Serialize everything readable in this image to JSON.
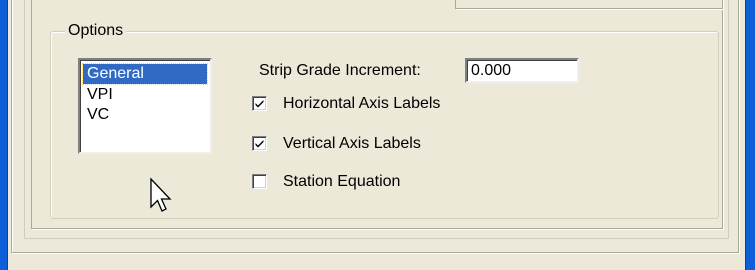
{
  "options_group": {
    "title": "Options",
    "list_items": [
      "General",
      "VPI",
      "VC"
    ],
    "selected_item": "General"
  },
  "strip_grade_increment": {
    "label": "Strip Grade Increment:",
    "value": "0.000"
  },
  "checkboxes": [
    {
      "label": "Horizontal Axis Labels",
      "checked": true
    },
    {
      "label": "Vertical Axis Labels",
      "checked": true
    },
    {
      "label": "Station Equation",
      "checked": false
    }
  ],
  "colors": {
    "window_frame": "#0c5fd9",
    "dialog_face": "#ece9d8",
    "selection": "#316ac5"
  },
  "icons": {
    "pointer": "arrow-cursor-icon"
  }
}
